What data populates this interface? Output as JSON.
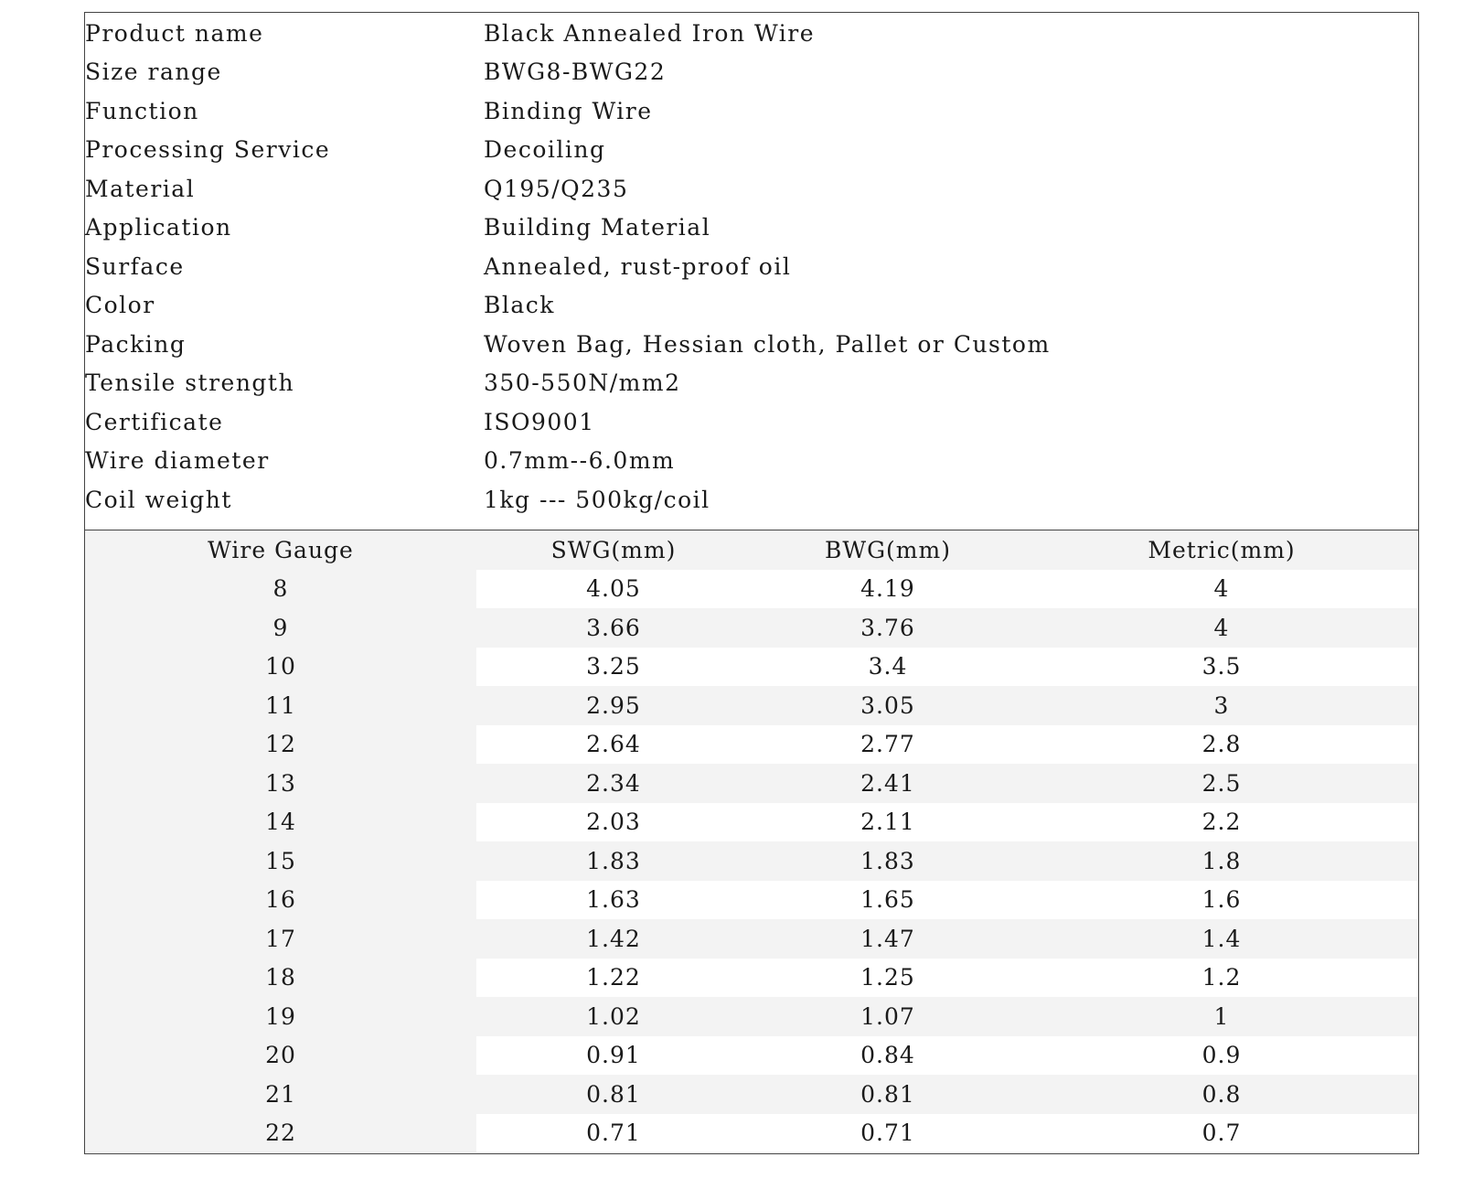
{
  "spec": {
    "rows": [
      {
        "label": "Product name",
        "value": "Black Annealed Iron Wire"
      },
      {
        "label": "Size range",
        "value": "BWG8-BWG22"
      },
      {
        "label": "Function",
        "value": "Binding Wire"
      },
      {
        "label": "Processing Service",
        "value": "Decoiling"
      },
      {
        "label": "Material",
        "value": "Q195/Q235"
      },
      {
        "label": "Application",
        "value": "Building Material"
      },
      {
        "label": "Surface",
        "value": "Annealed, rust-proof oil"
      },
      {
        "label": "Color",
        "value": "Black"
      },
      {
        "label": "Packing",
        "value": "Woven Bag, Hessian cloth, Pallet or Custom"
      },
      {
        "label": "Tensile strength",
        "value": "350-550N/mm2"
      },
      {
        "label": "Certificate",
        "value": "ISO9001"
      },
      {
        "label": "Wire diameter",
        "value": "0.7mm--6.0mm"
      },
      {
        "label": "Coil weight",
        "value": "1kg --- 500kg/coil"
      }
    ]
  },
  "gauge_table": {
    "headers": [
      "Wire Gauge",
      "SWG(mm)",
      "BWG(mm)",
      "Metric(mm)"
    ],
    "rows": [
      [
        "8",
        "4.05",
        "4.19",
        "4"
      ],
      [
        "9",
        "3.66",
        "3.76",
        "4"
      ],
      [
        "10",
        "3.25",
        "3.4",
        "3.5"
      ],
      [
        "11",
        "2.95",
        "3.05",
        "3"
      ],
      [
        "12",
        "2.64",
        "2.77",
        "2.8"
      ],
      [
        "13",
        "2.34",
        "2.41",
        "2.5"
      ],
      [
        "14",
        "2.03",
        "2.11",
        "2.2"
      ],
      [
        "15",
        "1.83",
        "1.83",
        "1.8"
      ],
      [
        "16",
        "1.63",
        "1.65",
        "1.6"
      ],
      [
        "17",
        "1.42",
        "1.47",
        "1.4"
      ],
      [
        "18",
        "1.22",
        "1.25",
        "1.2"
      ],
      [
        "19",
        "1.02",
        "1.07",
        "1"
      ],
      [
        "20",
        "0.91",
        "0.84",
        "0.9"
      ],
      [
        "21",
        "0.81",
        "0.81",
        "0.8"
      ],
      [
        "22",
        "0.71",
        "0.71",
        "0.7"
      ]
    ]
  }
}
